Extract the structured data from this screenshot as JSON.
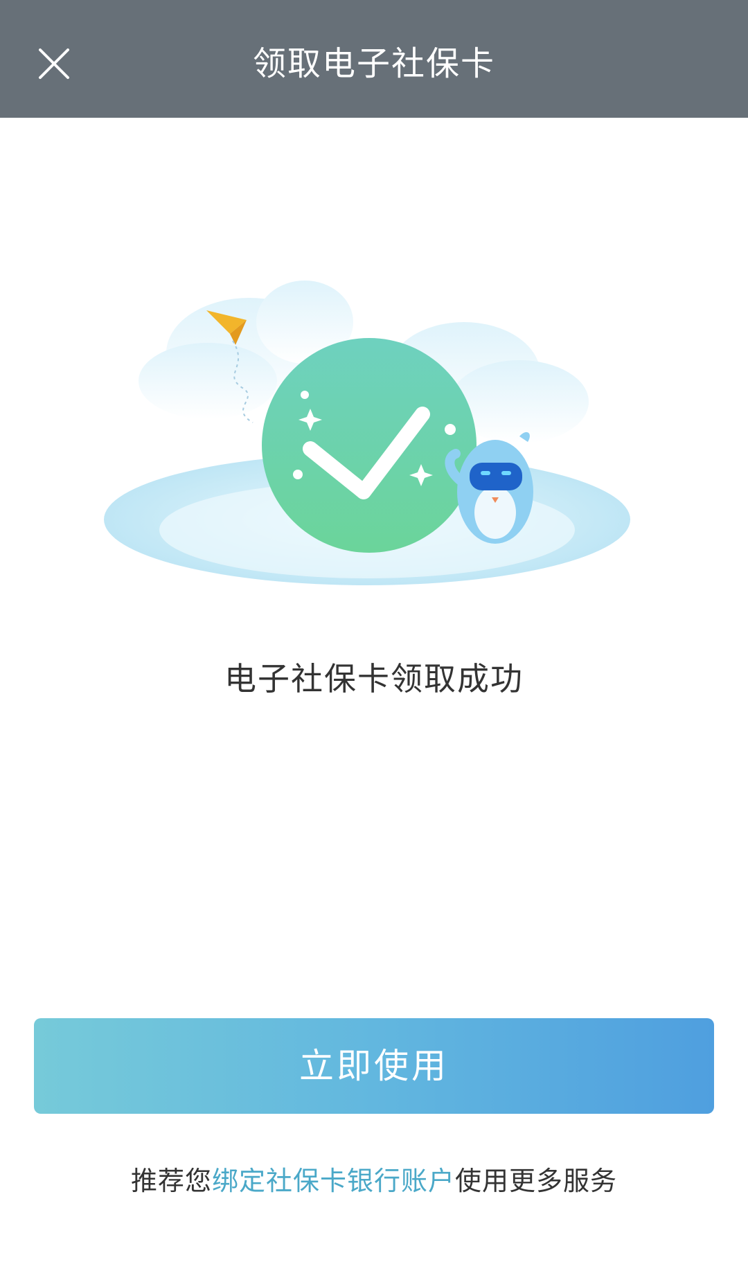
{
  "header": {
    "title": "领取电子社保卡",
    "close_icon": "close-icon"
  },
  "illustration": {
    "check_icon": "check-icon",
    "mascot": "penguin-mascot",
    "paper_plane": "paper-plane-icon",
    "colors": {
      "check_circle": "#6fd3b0",
      "cloud": "#d7f0fb",
      "mascot": "#8fd0f2",
      "mascot_mask": "#1f63c9",
      "plane": "#f2b52b"
    }
  },
  "main": {
    "success_text": "电子社保卡领取成功"
  },
  "actions": {
    "use_now_label": "立即使用"
  },
  "footer": {
    "prefix": "推荐您",
    "link": "绑定社保卡银行账户",
    "suffix": "使用更多服务"
  },
  "colors": {
    "header_bg": "#677078",
    "button_start": "#76cad9",
    "button_end": "#4f9fdf",
    "link": "#4aa8c8"
  }
}
